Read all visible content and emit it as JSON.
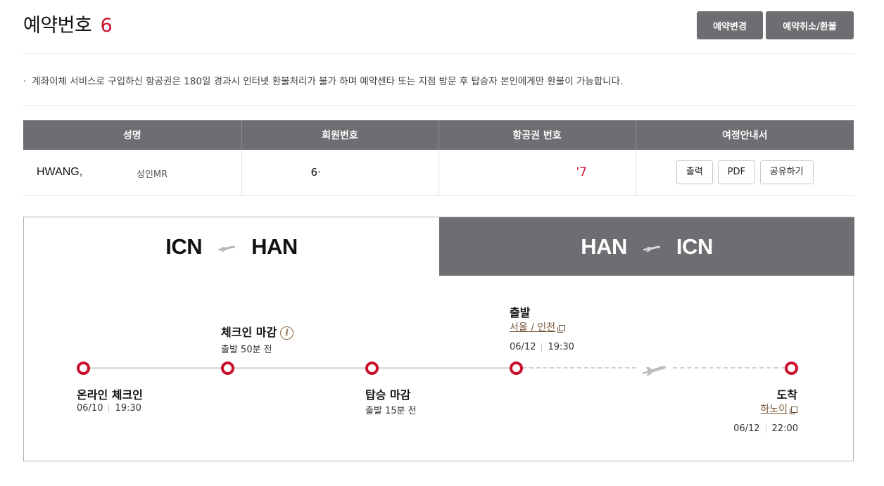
{
  "header": {
    "title": "예약번호",
    "reservation_number": "6",
    "change_button": "예약변경",
    "cancel_button": "예약취소/환불"
  },
  "notice": {
    "bullet": "·",
    "text": "계좌이체 서비스로 구입하신 항공권은 180일 경과시 인터넷 환불처리가 불가 하며 예약센타 또는 지점 방문 후 탑승자 본인에게만 환불이 가능합니다."
  },
  "passenger_table": {
    "headers": [
      "성명",
      "회원번호",
      "항공권 번호",
      "여정안내서"
    ],
    "row": {
      "name": "HWANG,",
      "passenger_type": "성인MR",
      "member_number": "6·",
      "ticket_number": "'7",
      "itinerary_buttons": [
        "출력",
        "PDF",
        "공유하기"
      ]
    }
  },
  "segments": [
    {
      "from": "ICN",
      "to": "HAN",
      "active": true
    },
    {
      "from": "HAN",
      "to": "ICN",
      "active": false
    }
  ],
  "timeline": {
    "online_checkin": {
      "label": "온라인 체크인",
      "date": "06/10",
      "time": "19:30"
    },
    "checkin_close": {
      "label": "체크인 마감",
      "note": "출발 50분 전",
      "info_icon": "info-icon"
    },
    "boarding_close": {
      "label": "탑승 마감",
      "note": "출발 15분 전"
    },
    "departure": {
      "label": "출발",
      "place": "서울 / 인천",
      "date": "06/12",
      "time": "19:30"
    },
    "arrival": {
      "label": "도착",
      "place": "하노이",
      "date": "06/12",
      "time": "22:00"
    }
  },
  "colors": {
    "accent_red": "#c8102e",
    "header_gray": "#6d6e71",
    "link_brown": "#7a5a3c"
  }
}
